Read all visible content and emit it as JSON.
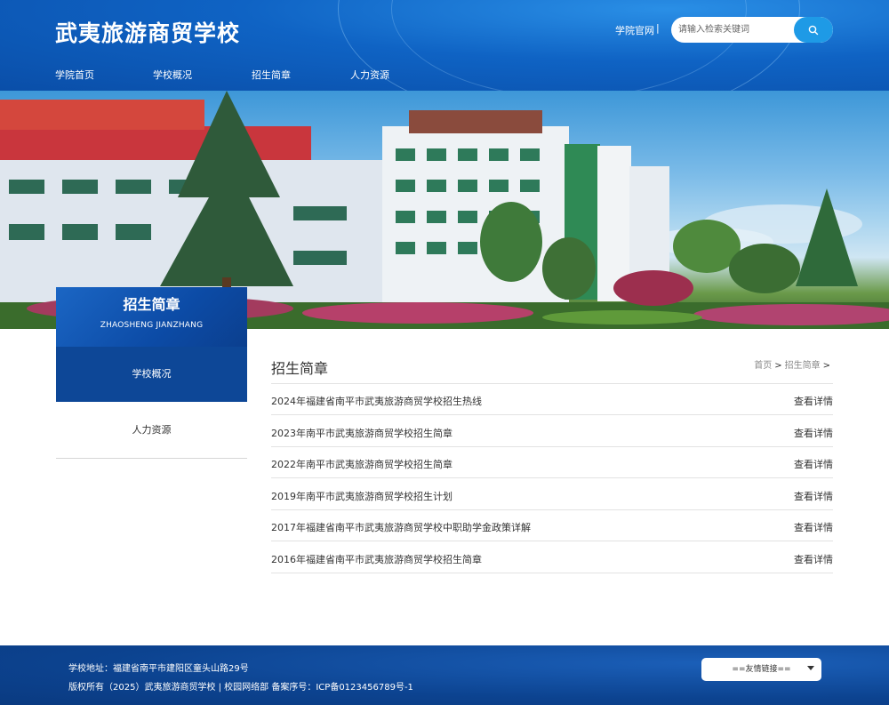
{
  "header": {
    "school_name": "武夷旅游商贸学校",
    "official_link": "学院官网",
    "separator": "|",
    "search": {
      "placeholder": "请输入检索关键词",
      "button_icon": "search-icon"
    },
    "nav": [
      "学院首页",
      "学校概况",
      "招生简章",
      "人力资源"
    ]
  },
  "sidebar": {
    "title": "招生简章",
    "subtitle": "ZHAOSHENG JIANZHANG",
    "items": [
      {
        "label": "学校概况",
        "active": true
      },
      {
        "label": "人力资源",
        "active": false
      }
    ]
  },
  "content": {
    "title": "招生简章",
    "breadcrumb": {
      "home": "首页",
      "current": "招生简章",
      "arrow": ">"
    },
    "articles": [
      {
        "title": "2024年福建省南平市武夷旅游商贸学校招生热线",
        "more": "查看详情"
      },
      {
        "title": "2023年南平市武夷旅游商贸学校招生简章",
        "more": "查看详情"
      },
      {
        "title": "2022年南平市武夷旅游商贸学校招生简章",
        "more": "查看详情"
      },
      {
        "title": "2019年南平市武夷旅游商贸学校招生计划",
        "more": "查看详情"
      },
      {
        "title": "2017年福建省南平市武夷旅游商贸学校中职助学金政策详解",
        "more": "查看详情"
      },
      {
        "title": "2016年福建省南平市武夷旅游商贸学校招生简章",
        "more": "查看详情"
      }
    ]
  },
  "footer": {
    "address": "学校地址：福建省南平市建阳区童头山路29号",
    "copyright": "版权所有（2025）武夷旅游商贸学校 | 校园网络部 备案序号：ICP备0123456789号-1",
    "links_select": "==友情链接=="
  },
  "colors": {
    "header_blue": "#0f63c4",
    "sidebar_active": "#0d4797",
    "search_button": "#1e9ae6",
    "footer_blue": "#0c4390"
  }
}
